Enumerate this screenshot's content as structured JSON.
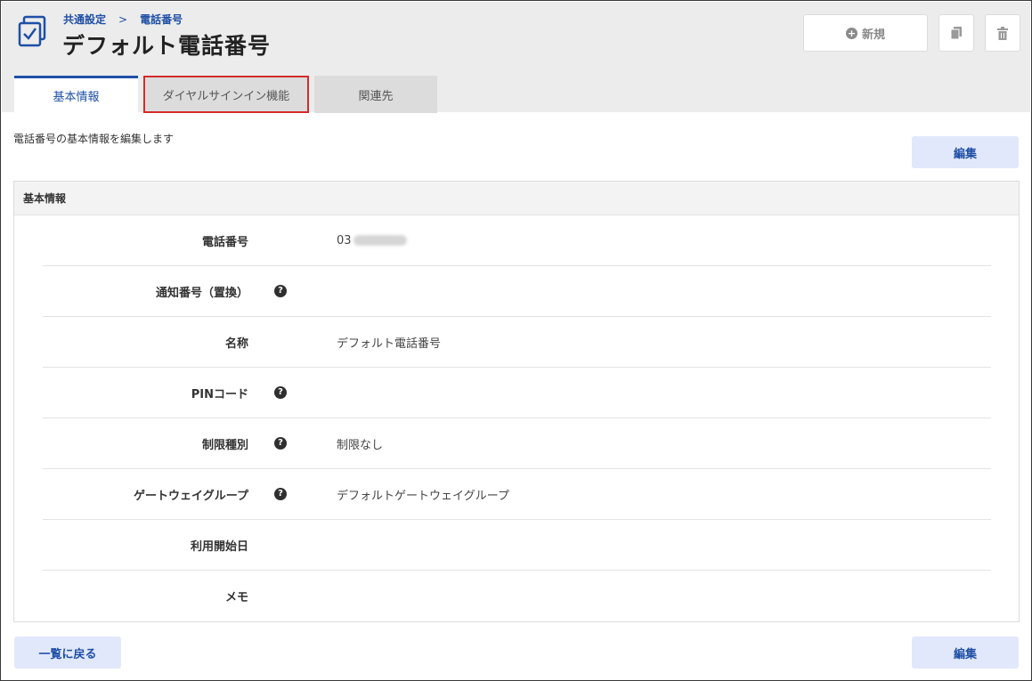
{
  "header": {
    "breadcrumb": [
      "共通設定",
      ">",
      "電話番号"
    ],
    "title": "デフォルト電話番号",
    "actions": {
      "new_label": "新規"
    }
  },
  "tabs": [
    {
      "label": "基本情報",
      "active": true
    },
    {
      "label": "ダイヤルサインイン機能",
      "highlighted": true
    },
    {
      "label": "関連先"
    }
  ],
  "description": "電話番号の基本情報を編集します",
  "edit_label": "編集",
  "back_label": "一覧に戻る",
  "panel": {
    "title": "基本情報",
    "rows": [
      {
        "label": "電話番号",
        "help": false,
        "value": "03"
      },
      {
        "label": "通知番号（置換）",
        "help": true,
        "value": ""
      },
      {
        "label": "名称",
        "help": false,
        "value": "デフォルト電話番号"
      },
      {
        "label": "PINコード",
        "help": true,
        "value": ""
      },
      {
        "label": "制限種別",
        "help": true,
        "value": "制限なし"
      },
      {
        "label": "ゲートウェイグループ",
        "help": true,
        "value": "デフォルトゲートウェイグループ"
      },
      {
        "label": "利用開始日",
        "help": false,
        "value": ""
      },
      {
        "label": "メモ",
        "help": false,
        "value": ""
      }
    ]
  },
  "colors": {
    "accent": "#1e4fa6",
    "header_bg": "#ececec",
    "button_bg": "#e2e8fb",
    "highlight_border": "#d42b2b"
  },
  "icons": [
    "checklist-icon",
    "plus-circle-icon",
    "copy-icon",
    "trash-icon",
    "help-icon"
  ]
}
